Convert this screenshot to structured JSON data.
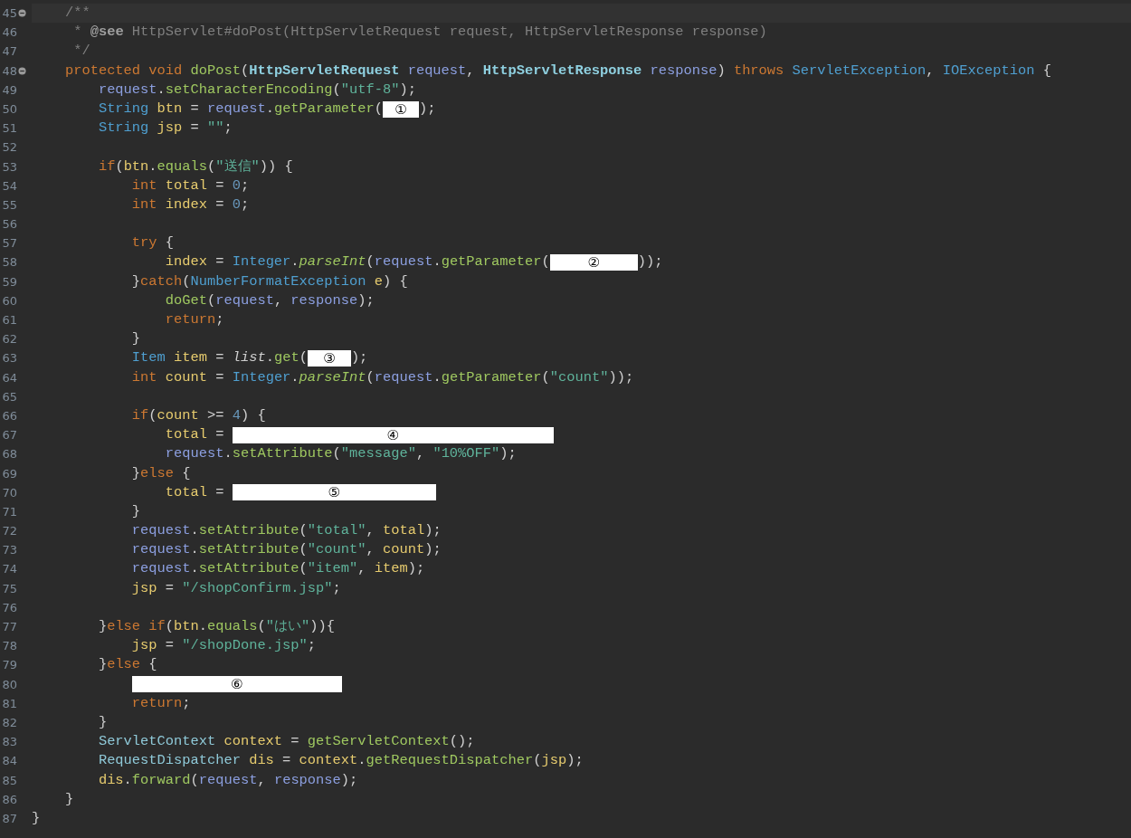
{
  "editor": {
    "lines": [
      {
        "number": "45",
        "fold": true,
        "current": true,
        "tokens": [
          {
            "kind": "comment",
            "text": "/**"
          }
        ]
      },
      {
        "number": "46",
        "tokens": [
          {
            "kind": "comment",
            "text": " * "
          },
          {
            "kind": "doc_tag",
            "text": "@see"
          },
          {
            "kind": "comment",
            "text": " HttpServlet#doPost(HttpServletRequest request, HttpServletResponse response)"
          }
        ]
      },
      {
        "number": "47",
        "tokens": [
          {
            "kind": "comment",
            "text": " */"
          }
        ]
      },
      {
        "number": "48",
        "fold": true,
        "tokens": [
          {
            "kind": "keyword",
            "text": "protected void "
          },
          {
            "kind": "method",
            "text": "doPost"
          },
          {
            "kind": "plain",
            "text": "("
          },
          {
            "kind": "param_type",
            "text": "HttpServletRequest "
          },
          {
            "kind": "param",
            "text": "request"
          },
          {
            "kind": "plain",
            "text": ", "
          },
          {
            "kind": "param_type",
            "text": "HttpServletResponse "
          },
          {
            "kind": "param",
            "text": "response"
          },
          {
            "kind": "plain",
            "text": ") "
          },
          {
            "kind": "keyword",
            "text": "throws "
          },
          {
            "kind": "type",
            "text": "ServletException"
          },
          {
            "kind": "plain",
            "text": ", "
          },
          {
            "kind": "type",
            "text": "IOException"
          },
          {
            "kind": "plain",
            "text": " {"
          }
        ]
      },
      {
        "number": "49",
        "tokens": [
          {
            "kind": "param",
            "text": "request"
          },
          {
            "kind": "plain",
            "text": "."
          },
          {
            "kind": "method",
            "text": "setCharacterEncoding"
          },
          {
            "kind": "plain",
            "text": "("
          },
          {
            "kind": "string",
            "text": "\"utf-8\""
          },
          {
            "kind": "plain",
            "text": ");"
          }
        ]
      },
      {
        "number": "50",
        "tokens": [
          {
            "kind": "type",
            "text": "String "
          },
          {
            "kind": "variable",
            "text": "btn"
          },
          {
            "kind": "plain",
            "text": " = "
          },
          {
            "kind": "param",
            "text": "request"
          },
          {
            "kind": "plain",
            "text": "."
          },
          {
            "kind": "method",
            "text": "getParameter"
          },
          {
            "kind": "plain",
            "text": "("
          },
          {
            "kind": "blank",
            "text": "①"
          },
          {
            "kind": "plain",
            "text": ");"
          }
        ]
      },
      {
        "number": "51",
        "tokens": [
          {
            "kind": "type",
            "text": "String "
          },
          {
            "kind": "variable",
            "text": "jsp"
          },
          {
            "kind": "plain",
            "text": " = "
          },
          {
            "kind": "string",
            "text": "\"\""
          },
          {
            "kind": "plain",
            "text": ";"
          }
        ]
      },
      {
        "number": "52"
      },
      {
        "number": "53",
        "tokens": [
          {
            "kind": "keyword",
            "text": "if"
          },
          {
            "kind": "plain",
            "text": "("
          },
          {
            "kind": "variable",
            "text": "btn"
          },
          {
            "kind": "plain",
            "text": "."
          },
          {
            "kind": "method",
            "text": "equals"
          },
          {
            "kind": "plain",
            "text": "("
          },
          {
            "kind": "string",
            "text": "\"送信\""
          },
          {
            "kind": "plain",
            "text": ")) {"
          }
        ]
      },
      {
        "number": "54",
        "tokens": [
          {
            "kind": "keyword",
            "text": "int "
          },
          {
            "kind": "variable",
            "text": "total"
          },
          {
            "kind": "plain",
            "text": " = "
          },
          {
            "kind": "number",
            "text": "0"
          },
          {
            "kind": "plain",
            "text": ";"
          }
        ]
      },
      {
        "number": "55",
        "tokens": [
          {
            "kind": "keyword",
            "text": "int "
          },
          {
            "kind": "variable",
            "text": "index"
          },
          {
            "kind": "plain",
            "text": " = "
          },
          {
            "kind": "number",
            "text": "0"
          },
          {
            "kind": "plain",
            "text": ";"
          }
        ]
      },
      {
        "number": "56"
      },
      {
        "number": "57",
        "tokens": [
          {
            "kind": "keyword",
            "text": "try"
          },
          {
            "kind": "plain",
            "text": " {"
          }
        ]
      },
      {
        "number": "58",
        "tokens": [
          {
            "kind": "variable",
            "text": "index"
          },
          {
            "kind": "plain",
            "text": " = "
          },
          {
            "kind": "type",
            "text": "Integer"
          },
          {
            "kind": "plain",
            "text": "."
          },
          {
            "kind": "static_method",
            "text": "parseInt"
          },
          {
            "kind": "plain",
            "text": "("
          },
          {
            "kind": "param",
            "text": "request"
          },
          {
            "kind": "plain",
            "text": "."
          },
          {
            "kind": "method",
            "text": "getParameter"
          },
          {
            "kind": "plain",
            "text": "("
          },
          {
            "kind": "blank",
            "text": "②"
          },
          {
            "kind": "plain",
            "text": "));"
          }
        ]
      },
      {
        "number": "59",
        "tokens": [
          {
            "kind": "plain",
            "text": "}"
          },
          {
            "kind": "keyword",
            "text": "catch"
          },
          {
            "kind": "plain",
            "text": "("
          },
          {
            "kind": "type",
            "text": "NumberFormatException "
          },
          {
            "kind": "variable",
            "text": "e"
          },
          {
            "kind": "plain",
            "text": ") {"
          }
        ]
      },
      {
        "number": "60",
        "tokens": [
          {
            "kind": "method",
            "text": "doGet"
          },
          {
            "kind": "plain",
            "text": "("
          },
          {
            "kind": "param",
            "text": "request"
          },
          {
            "kind": "plain",
            "text": ", "
          },
          {
            "kind": "param",
            "text": "response"
          },
          {
            "kind": "plain",
            "text": ");"
          }
        ]
      },
      {
        "number": "61",
        "tokens": [
          {
            "kind": "keyword",
            "text": "return"
          },
          {
            "kind": "plain",
            "text": ";"
          }
        ]
      },
      {
        "number": "62",
        "tokens": [
          {
            "kind": "plain",
            "text": "}"
          }
        ]
      },
      {
        "number": "63",
        "tokens": [
          {
            "kind": "type",
            "text": "Item "
          },
          {
            "kind": "variable",
            "text": "item"
          },
          {
            "kind": "plain",
            "text": " = "
          },
          {
            "kind": "static_field",
            "text": "list"
          },
          {
            "kind": "plain",
            "text": "."
          },
          {
            "kind": "method",
            "text": "get"
          },
          {
            "kind": "plain",
            "text": "("
          },
          {
            "kind": "blank",
            "text": "③"
          },
          {
            "kind": "plain",
            "text": ");"
          }
        ]
      },
      {
        "number": "64",
        "tokens": [
          {
            "kind": "keyword",
            "text": "int "
          },
          {
            "kind": "variable",
            "text": "count"
          },
          {
            "kind": "plain",
            "text": " = "
          },
          {
            "kind": "type",
            "text": "Integer"
          },
          {
            "kind": "plain",
            "text": "."
          },
          {
            "kind": "static_method",
            "text": "parseInt"
          },
          {
            "kind": "plain",
            "text": "("
          },
          {
            "kind": "param",
            "text": "request"
          },
          {
            "kind": "plain",
            "text": "."
          },
          {
            "kind": "method",
            "text": "getParameter"
          },
          {
            "kind": "plain",
            "text": "("
          },
          {
            "kind": "string",
            "text": "\"count\""
          },
          {
            "kind": "plain",
            "text": "));"
          }
        ]
      },
      {
        "number": "65"
      },
      {
        "number": "66",
        "tokens": [
          {
            "kind": "keyword",
            "text": "if"
          },
          {
            "kind": "plain",
            "text": "("
          },
          {
            "kind": "variable",
            "text": "count"
          },
          {
            "kind": "plain",
            "text": " >= "
          },
          {
            "kind": "number",
            "text": "4"
          },
          {
            "kind": "plain",
            "text": ") {"
          }
        ]
      },
      {
        "number": "67",
        "tokens": [
          {
            "kind": "variable",
            "text": "total"
          },
          {
            "kind": "plain",
            "text": " = "
          },
          {
            "kind": "blank",
            "text": "④"
          }
        ]
      },
      {
        "number": "68",
        "tokens": [
          {
            "kind": "param",
            "text": "request"
          },
          {
            "kind": "plain",
            "text": "."
          },
          {
            "kind": "method",
            "text": "setAttribute"
          },
          {
            "kind": "plain",
            "text": "("
          },
          {
            "kind": "string",
            "text": "\"message\""
          },
          {
            "kind": "plain",
            "text": ", "
          },
          {
            "kind": "string",
            "text": "\"10%OFF\""
          },
          {
            "kind": "plain",
            "text": ");"
          }
        ]
      },
      {
        "number": "69",
        "tokens": [
          {
            "kind": "plain",
            "text": "}"
          },
          {
            "kind": "keyword",
            "text": "else"
          },
          {
            "kind": "plain",
            "text": " {"
          }
        ]
      },
      {
        "number": "70",
        "tokens": [
          {
            "kind": "variable",
            "text": "total"
          },
          {
            "kind": "plain",
            "text": " = "
          },
          {
            "kind": "blank",
            "text": "⑤"
          }
        ]
      },
      {
        "number": "71",
        "tokens": [
          {
            "kind": "plain",
            "text": "}"
          }
        ]
      },
      {
        "number": "72",
        "tokens": [
          {
            "kind": "param",
            "text": "request"
          },
          {
            "kind": "plain",
            "text": "."
          },
          {
            "kind": "method",
            "text": "setAttribute"
          },
          {
            "kind": "plain",
            "text": "("
          },
          {
            "kind": "string",
            "text": "\"total\""
          },
          {
            "kind": "plain",
            "text": ", "
          },
          {
            "kind": "variable",
            "text": "total"
          },
          {
            "kind": "plain",
            "text": ");"
          }
        ]
      },
      {
        "number": "73",
        "tokens": [
          {
            "kind": "param",
            "text": "request"
          },
          {
            "kind": "plain",
            "text": "."
          },
          {
            "kind": "method",
            "text": "setAttribute"
          },
          {
            "kind": "plain",
            "text": "("
          },
          {
            "kind": "string",
            "text": "\"count\""
          },
          {
            "kind": "plain",
            "text": ", "
          },
          {
            "kind": "variable",
            "text": "count"
          },
          {
            "kind": "plain",
            "text": ");"
          }
        ]
      },
      {
        "number": "74",
        "tokens": [
          {
            "kind": "param",
            "text": "request"
          },
          {
            "kind": "plain",
            "text": "."
          },
          {
            "kind": "method",
            "text": "setAttribute"
          },
          {
            "kind": "plain",
            "text": "("
          },
          {
            "kind": "string",
            "text": "\"item\""
          },
          {
            "kind": "plain",
            "text": ", "
          },
          {
            "kind": "variable",
            "text": "item"
          },
          {
            "kind": "plain",
            "text": ");"
          }
        ]
      },
      {
        "number": "75",
        "tokens": [
          {
            "kind": "variable",
            "text": "jsp"
          },
          {
            "kind": "plain",
            "text": " = "
          },
          {
            "kind": "string",
            "text": "\"/shopConfirm.jsp\""
          },
          {
            "kind": "plain",
            "text": ";"
          }
        ]
      },
      {
        "number": "76"
      },
      {
        "number": "77",
        "tokens": [
          {
            "kind": "plain",
            "text": "}"
          },
          {
            "kind": "keyword",
            "text": "else if"
          },
          {
            "kind": "plain",
            "text": "("
          },
          {
            "kind": "variable",
            "text": "btn"
          },
          {
            "kind": "plain",
            "text": "."
          },
          {
            "kind": "method",
            "text": "equals"
          },
          {
            "kind": "plain",
            "text": "("
          },
          {
            "kind": "string",
            "text": "\"はい\""
          },
          {
            "kind": "plain",
            "text": ")){"
          }
        ]
      },
      {
        "number": "78",
        "tokens": [
          {
            "kind": "variable",
            "text": "jsp"
          },
          {
            "kind": "plain",
            "text": " = "
          },
          {
            "kind": "string",
            "text": "\"/shopDone.jsp\""
          },
          {
            "kind": "plain",
            "text": ";"
          }
        ]
      },
      {
        "number": "79",
        "tokens": [
          {
            "kind": "plain",
            "text": "}"
          },
          {
            "kind": "keyword",
            "text": "else"
          },
          {
            "kind": "plain",
            "text": " {"
          }
        ]
      },
      {
        "number": "80",
        "tokens": [
          {
            "kind": "blank",
            "text": "⑥"
          }
        ]
      },
      {
        "number": "81",
        "tokens": [
          {
            "kind": "keyword",
            "text": "return"
          },
          {
            "kind": "plain",
            "text": ";"
          }
        ]
      },
      {
        "number": "82",
        "tokens": [
          {
            "kind": "plain",
            "text": "}"
          }
        ]
      },
      {
        "number": "83",
        "tokens": [
          {
            "kind": "class",
            "text": "ServletContext "
          },
          {
            "kind": "variable",
            "text": "context"
          },
          {
            "kind": "plain",
            "text": " = "
          },
          {
            "kind": "method",
            "text": "getServletContext"
          },
          {
            "kind": "plain",
            "text": "();"
          }
        ]
      },
      {
        "number": "84",
        "tokens": [
          {
            "kind": "class",
            "text": "RequestDispatcher "
          },
          {
            "kind": "variable",
            "text": "dis"
          },
          {
            "kind": "plain",
            "text": " = "
          },
          {
            "kind": "variable",
            "text": "context"
          },
          {
            "kind": "plain",
            "text": "."
          },
          {
            "kind": "method",
            "text": "getRequestDispatcher"
          },
          {
            "kind": "plain",
            "text": "("
          },
          {
            "kind": "variable",
            "text": "jsp"
          },
          {
            "kind": "plain",
            "text": ");"
          }
        ]
      },
      {
        "number": "85",
        "tokens": [
          {
            "kind": "variable",
            "text": "dis"
          },
          {
            "kind": "plain",
            "text": "."
          },
          {
            "kind": "method",
            "text": "forward"
          },
          {
            "kind": "plain",
            "text": "("
          },
          {
            "kind": "param",
            "text": "request"
          },
          {
            "kind": "plain",
            "text": ", "
          },
          {
            "kind": "param",
            "text": "response"
          },
          {
            "kind": "plain",
            "text": ");"
          }
        ]
      },
      {
        "number": "86",
        "tokens": [
          {
            "kind": "plain",
            "text": "}"
          }
        ]
      },
      {
        "number": "87",
        "tokens": [
          {
            "kind": "plain",
            "text": "}"
          }
        ]
      }
    ]
  }
}
